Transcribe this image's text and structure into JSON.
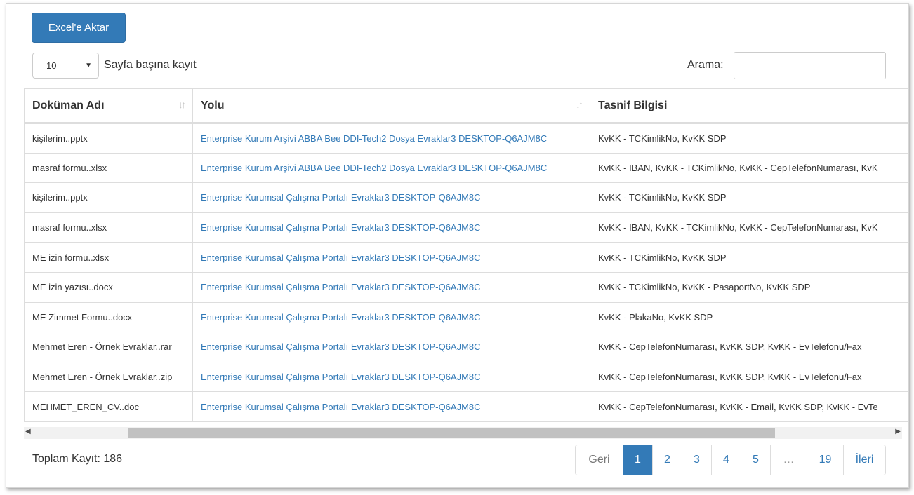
{
  "toolbar": {
    "export_label": "Excel'e Aktar"
  },
  "length": {
    "value": "10",
    "label": "Sayfa başına kayıt"
  },
  "search": {
    "label": "Arama:",
    "value": ""
  },
  "table": {
    "headers": [
      "Doküman Adı",
      "Yolu",
      "Tasnif Bilgisi"
    ],
    "rows": [
      [
        "kişilerim..pptx",
        "Enterprise Kurum Arşivi ABBA Bee DDI-Tech2 Dosya Evraklar3 DESKTOP-Q6AJM8C",
        "KvKK - TCKimlikNo, KvKK SDP"
      ],
      [
        "masraf formu..xlsx",
        "Enterprise Kurum Arşivi ABBA Bee DDI-Tech2 Dosya Evraklar3 DESKTOP-Q6AJM8C",
        "KvKK - IBAN, KvKK - TCKimlikNo, KvKK - CepTelefonNumarası, KvK"
      ],
      [
        "kişilerim..pptx",
        "Enterprise Kurumsal Çalışma Portalı Evraklar3 DESKTOP-Q6AJM8C",
        "KvKK - TCKimlikNo, KvKK SDP"
      ],
      [
        "masraf formu..xlsx",
        "Enterprise Kurumsal Çalışma Portalı Evraklar3 DESKTOP-Q6AJM8C",
        "KvKK - IBAN, KvKK - TCKimlikNo, KvKK - CepTelefonNumarası, KvK"
      ],
      [
        "ME izin formu..xlsx",
        "Enterprise Kurumsal Çalışma Portalı Evraklar3 DESKTOP-Q6AJM8C",
        "KvKK - TCKimlikNo, KvKK SDP"
      ],
      [
        "ME izin yazısı..docx",
        "Enterprise Kurumsal Çalışma Portalı Evraklar3 DESKTOP-Q6AJM8C",
        "KvKK - TCKimlikNo, KvKK - PasaportNo, KvKK SDP"
      ],
      [
        "ME Zimmet Formu..docx",
        "Enterprise Kurumsal Çalışma Portalı Evraklar3 DESKTOP-Q6AJM8C",
        "KvKK - PlakaNo, KvKK SDP"
      ],
      [
        "Mehmet Eren - Örnek Evraklar..rar",
        "Enterprise Kurumsal Çalışma Portalı Evraklar3 DESKTOP-Q6AJM8C",
        "KvKK - CepTelefonNumarası, KvKK SDP, KvKK - EvTelefonu/Fax"
      ],
      [
        "Mehmet Eren - Örnek Evraklar..zip",
        "Enterprise Kurumsal Çalışma Portalı Evraklar3 DESKTOP-Q6AJM8C",
        "KvKK - CepTelefonNumarası, KvKK SDP, KvKK - EvTelefonu/Fax"
      ],
      [
        "MEHMET_EREN_CV..doc",
        "Enterprise Kurumsal Çalışma Portalı Evraklar3 DESKTOP-Q6AJM8C",
        "KvKK - CepTelefonNumarası, KvKK - Email, KvKK SDP, KvKK - EvTe"
      ]
    ]
  },
  "footer": {
    "total_label": "Toplam Kayıt: 186"
  },
  "pagination": {
    "prev": "Geri",
    "pages": [
      "1",
      "2",
      "3",
      "4",
      "5",
      "…",
      "19"
    ],
    "active": "1",
    "next": "İleri"
  },
  "colors": {
    "accent": "#337ab7",
    "border": "#dddddd",
    "scroll_thumb": "#c1c1c1"
  }
}
